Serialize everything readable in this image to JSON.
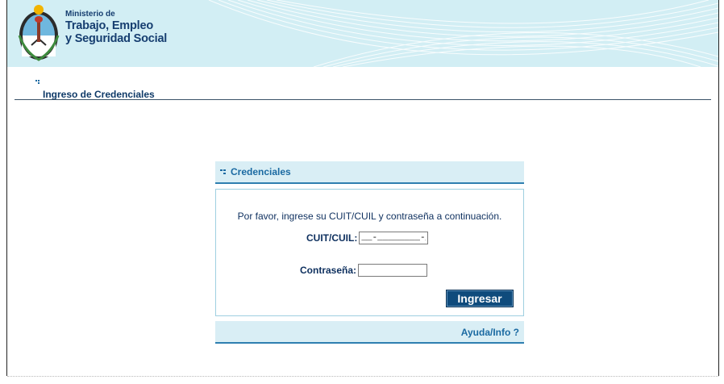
{
  "header": {
    "ministry_line1": "Ministerio de",
    "ministry_line2": "Trabajo, Empleo",
    "ministry_line3": "y Seguridad Social",
    "bg_color": "#d2eef4",
    "text_color": "#163e70"
  },
  "page": {
    "title": "Ingreso de Credenciales",
    "title_icon": "bullet-icon"
  },
  "credentials": {
    "header_label": "Credenciales",
    "instructions": "Por favor, ingrese su CUIT/CUIL y contraseña a continuación.",
    "cuit_label": "CUIT/CUIL:",
    "cuit_value": "__-________-_",
    "password_label": "Contraseña:",
    "password_value": "",
    "submit_label": "Ingresar",
    "help_label": "Ayuda/Info ?"
  },
  "colors": {
    "accent": "#1b6aa2",
    "button": "#0f4b7c",
    "panel_bg": "#d9eef5"
  }
}
